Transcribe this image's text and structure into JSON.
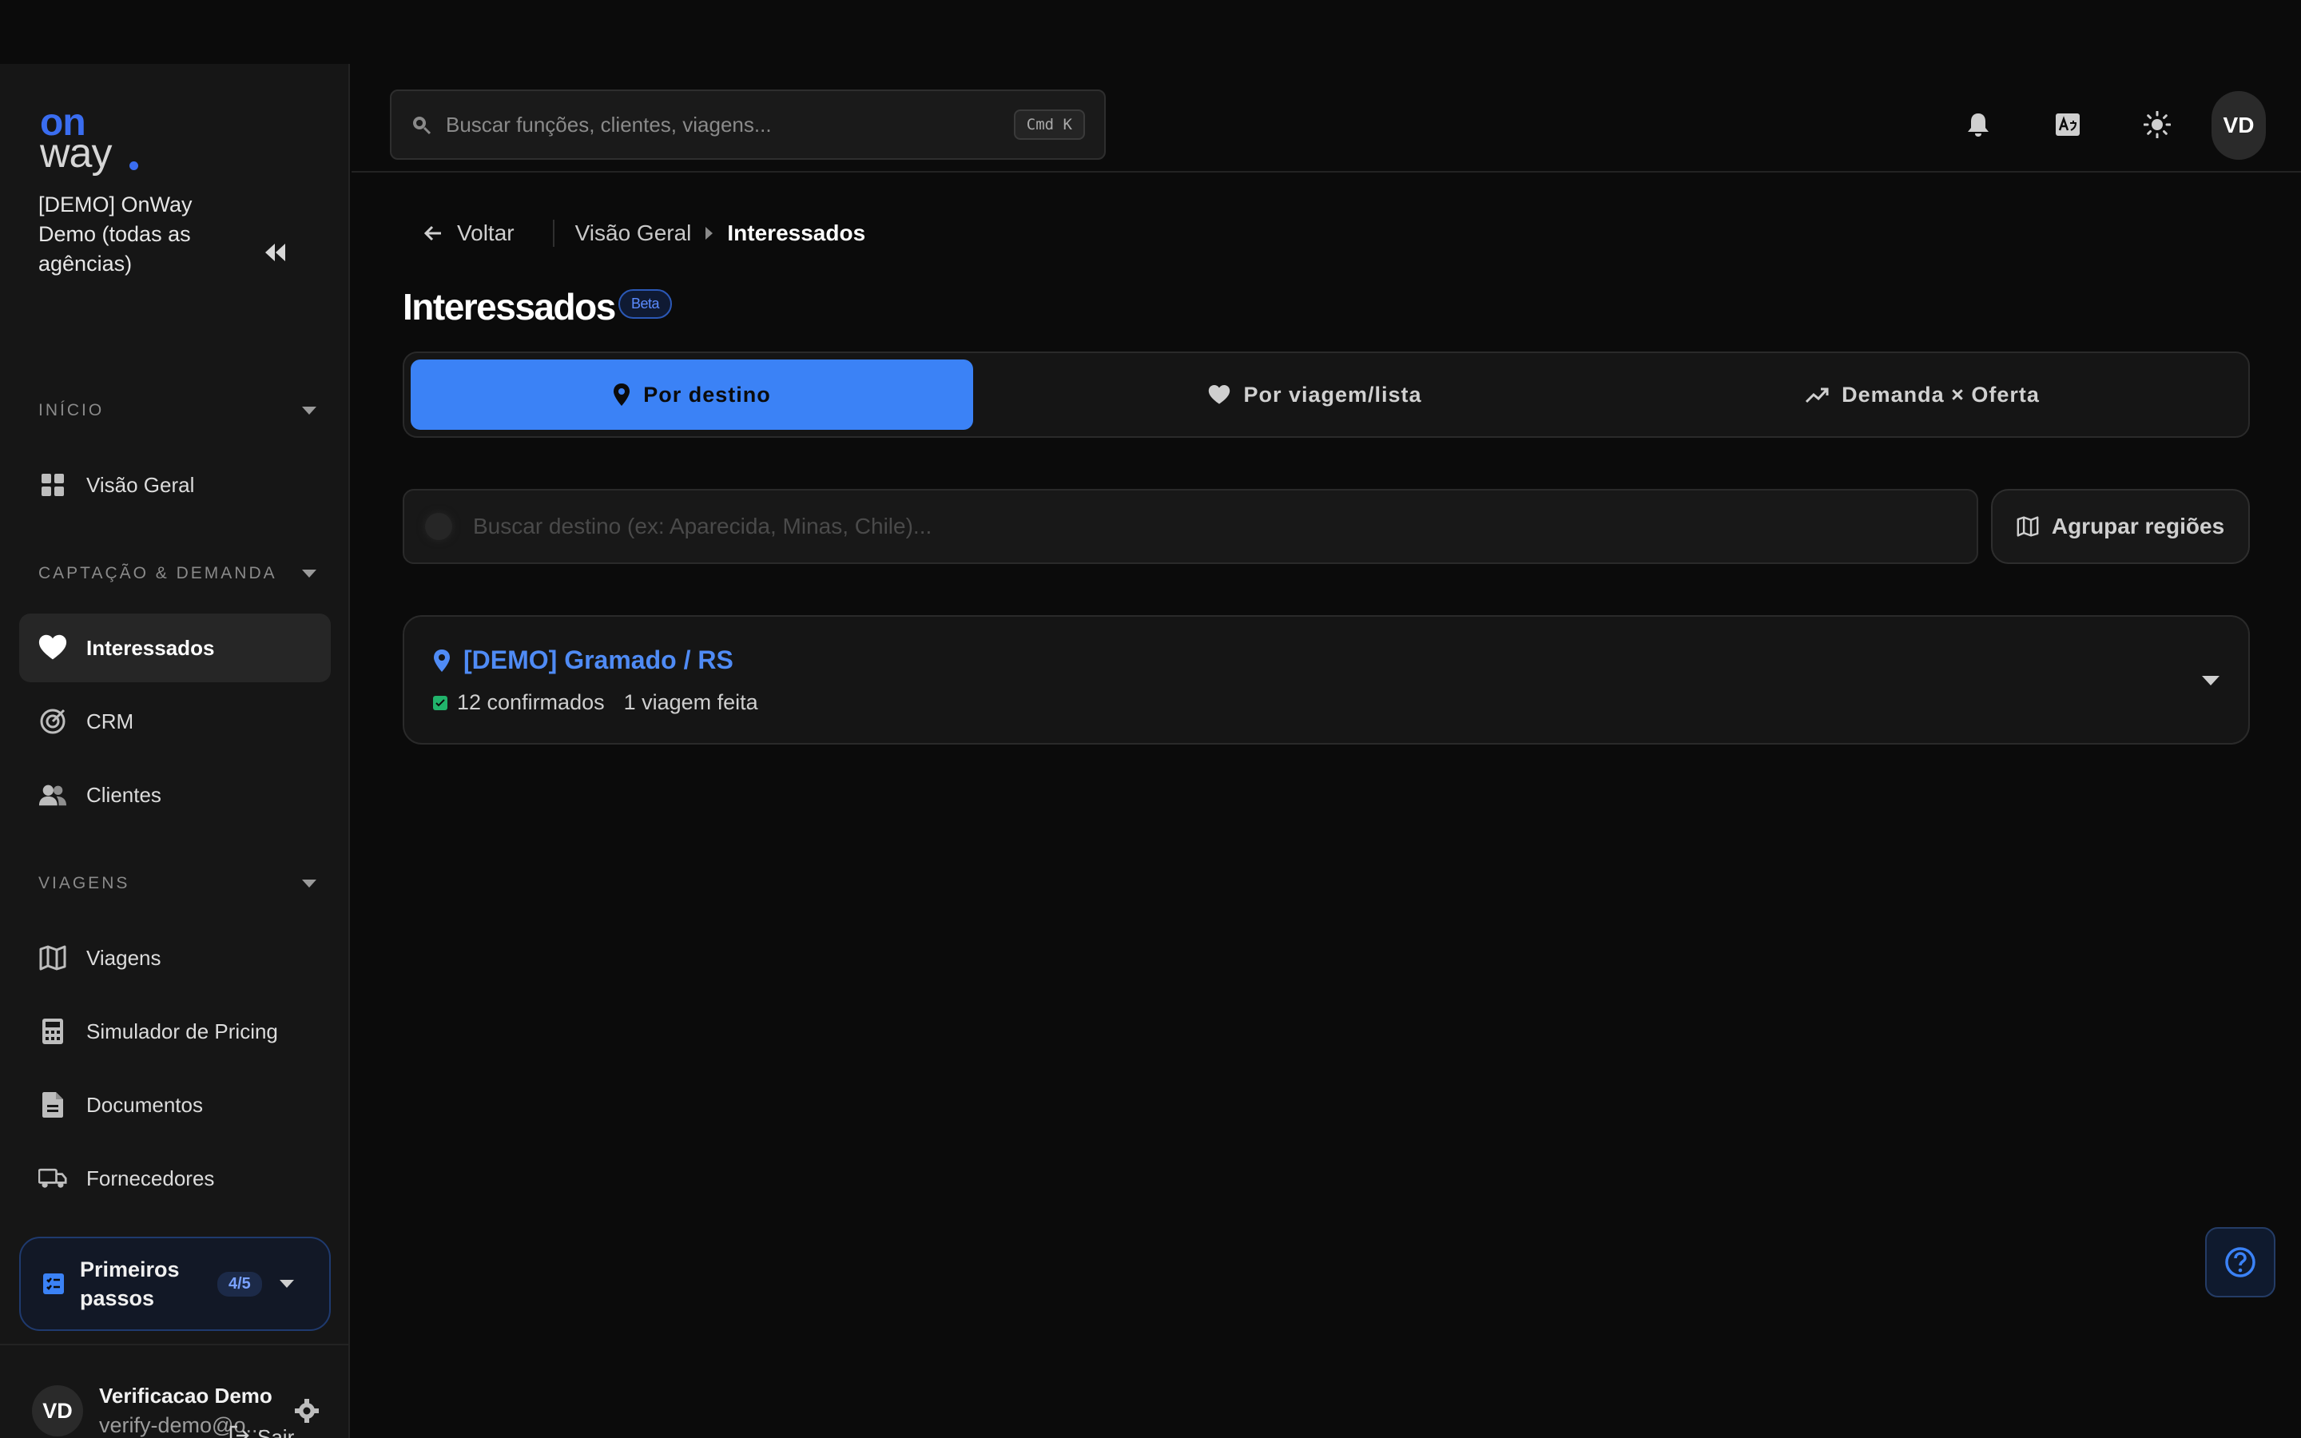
{
  "brand": {
    "logo_top": "on",
    "logo_bottom": "way",
    "accent": "#3b82f6"
  },
  "sidebar": {
    "org_name": "[DEMO] OnWay Demo (todas as agências)",
    "sections": [
      {
        "title": "INÍCIO",
        "items": [
          {
            "label": "Visão Geral",
            "icon": "grid-icon"
          }
        ]
      },
      {
        "title": "CAPTAÇÃO & DEMANDA",
        "items": [
          {
            "label": "Interessados",
            "icon": "heart-icon",
            "active": true
          },
          {
            "label": "CRM",
            "icon": "target-icon"
          },
          {
            "label": "Clientes",
            "icon": "users-icon"
          }
        ]
      },
      {
        "title": "VIAGENS",
        "items": [
          {
            "label": "Viagens",
            "icon": "map-icon"
          },
          {
            "label": "Simulador de Pricing",
            "icon": "calculator-icon"
          },
          {
            "label": "Documentos",
            "icon": "document-icon"
          },
          {
            "label": "Fornecedores",
            "icon": "truck-icon"
          }
        ]
      }
    ],
    "steps": {
      "label": "Primeiros passos",
      "progress": "4/5"
    },
    "user": {
      "initials": "VD",
      "name": "Verificacao Demo",
      "email": "verify-demo@o..."
    },
    "logout_label": "Sair"
  },
  "topbar": {
    "search_placeholder": "Buscar funções, clientes, viagens...",
    "shortcut": "Cmd K",
    "avatar": "VD",
    "icons": [
      "bell-icon",
      "translate-icon",
      "sun-icon"
    ]
  },
  "breadcrumb": {
    "back": "Voltar",
    "parent": "Visão Geral",
    "current": "Interessados"
  },
  "page": {
    "title": "Interessados",
    "badge": "Beta"
  },
  "tabs": [
    {
      "label": "Por destino",
      "icon": "pin-icon",
      "active": true
    },
    {
      "label": "Por viagem/lista",
      "icon": "heart-icon"
    },
    {
      "label": "Demanda × Oferta",
      "icon": "trend-icon"
    }
  ],
  "filter": {
    "placeholder": "Buscar destino (ex: Aparecida, Minas, Chile)...",
    "group_button": "Agrupar regiões"
  },
  "destinations": [
    {
      "name": "[DEMO] Gramado / RS",
      "confirmed": "12 confirmados",
      "trips": "1 viagem feita"
    }
  ]
}
